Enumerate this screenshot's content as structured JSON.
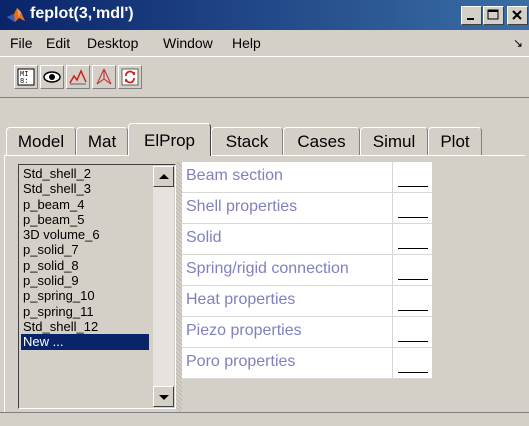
{
  "window": {
    "title": "feplot(3,'mdl')"
  },
  "menu": {
    "items": [
      "File",
      "Edit",
      "Desktop",
      "Window",
      "Help"
    ]
  },
  "toolbar": {
    "icons": [
      "model-properties-icon",
      "eye-icon",
      "mode-curve-icon",
      "deformed-mesh-icon",
      "refresh-icon"
    ]
  },
  "tabs": [
    {
      "label": "Model",
      "active": false
    },
    {
      "label": "Mat",
      "active": false
    },
    {
      "label": "ElProp",
      "active": true
    },
    {
      "label": "Stack",
      "active": false
    },
    {
      "label": "Cases",
      "active": false
    },
    {
      "label": "Simul",
      "active": false
    },
    {
      "label": "Plot",
      "active": false
    }
  ],
  "list": {
    "items": [
      "Std_shell_2",
      "Std_shell_3",
      "p_beam_4",
      "p_beam_5",
      "3D volume_6",
      "p_solid_7",
      "p_solid_8",
      "p_solid_9",
      "p_spring_10",
      "p_spring_11",
      "Std_shell_12",
      "New ..."
    ],
    "selected_index": 11
  },
  "properties": {
    "rows": [
      "Beam section",
      "Shell properties",
      "Solid",
      "Spring/rigid connection",
      "Heat properties",
      "Piezo properties",
      "Poro properties"
    ]
  },
  "colors": {
    "title_bar": "#0a246a",
    "selection": "#0a246a",
    "property_label": "#8080c0",
    "panel_bg": "#d4d0c8"
  }
}
